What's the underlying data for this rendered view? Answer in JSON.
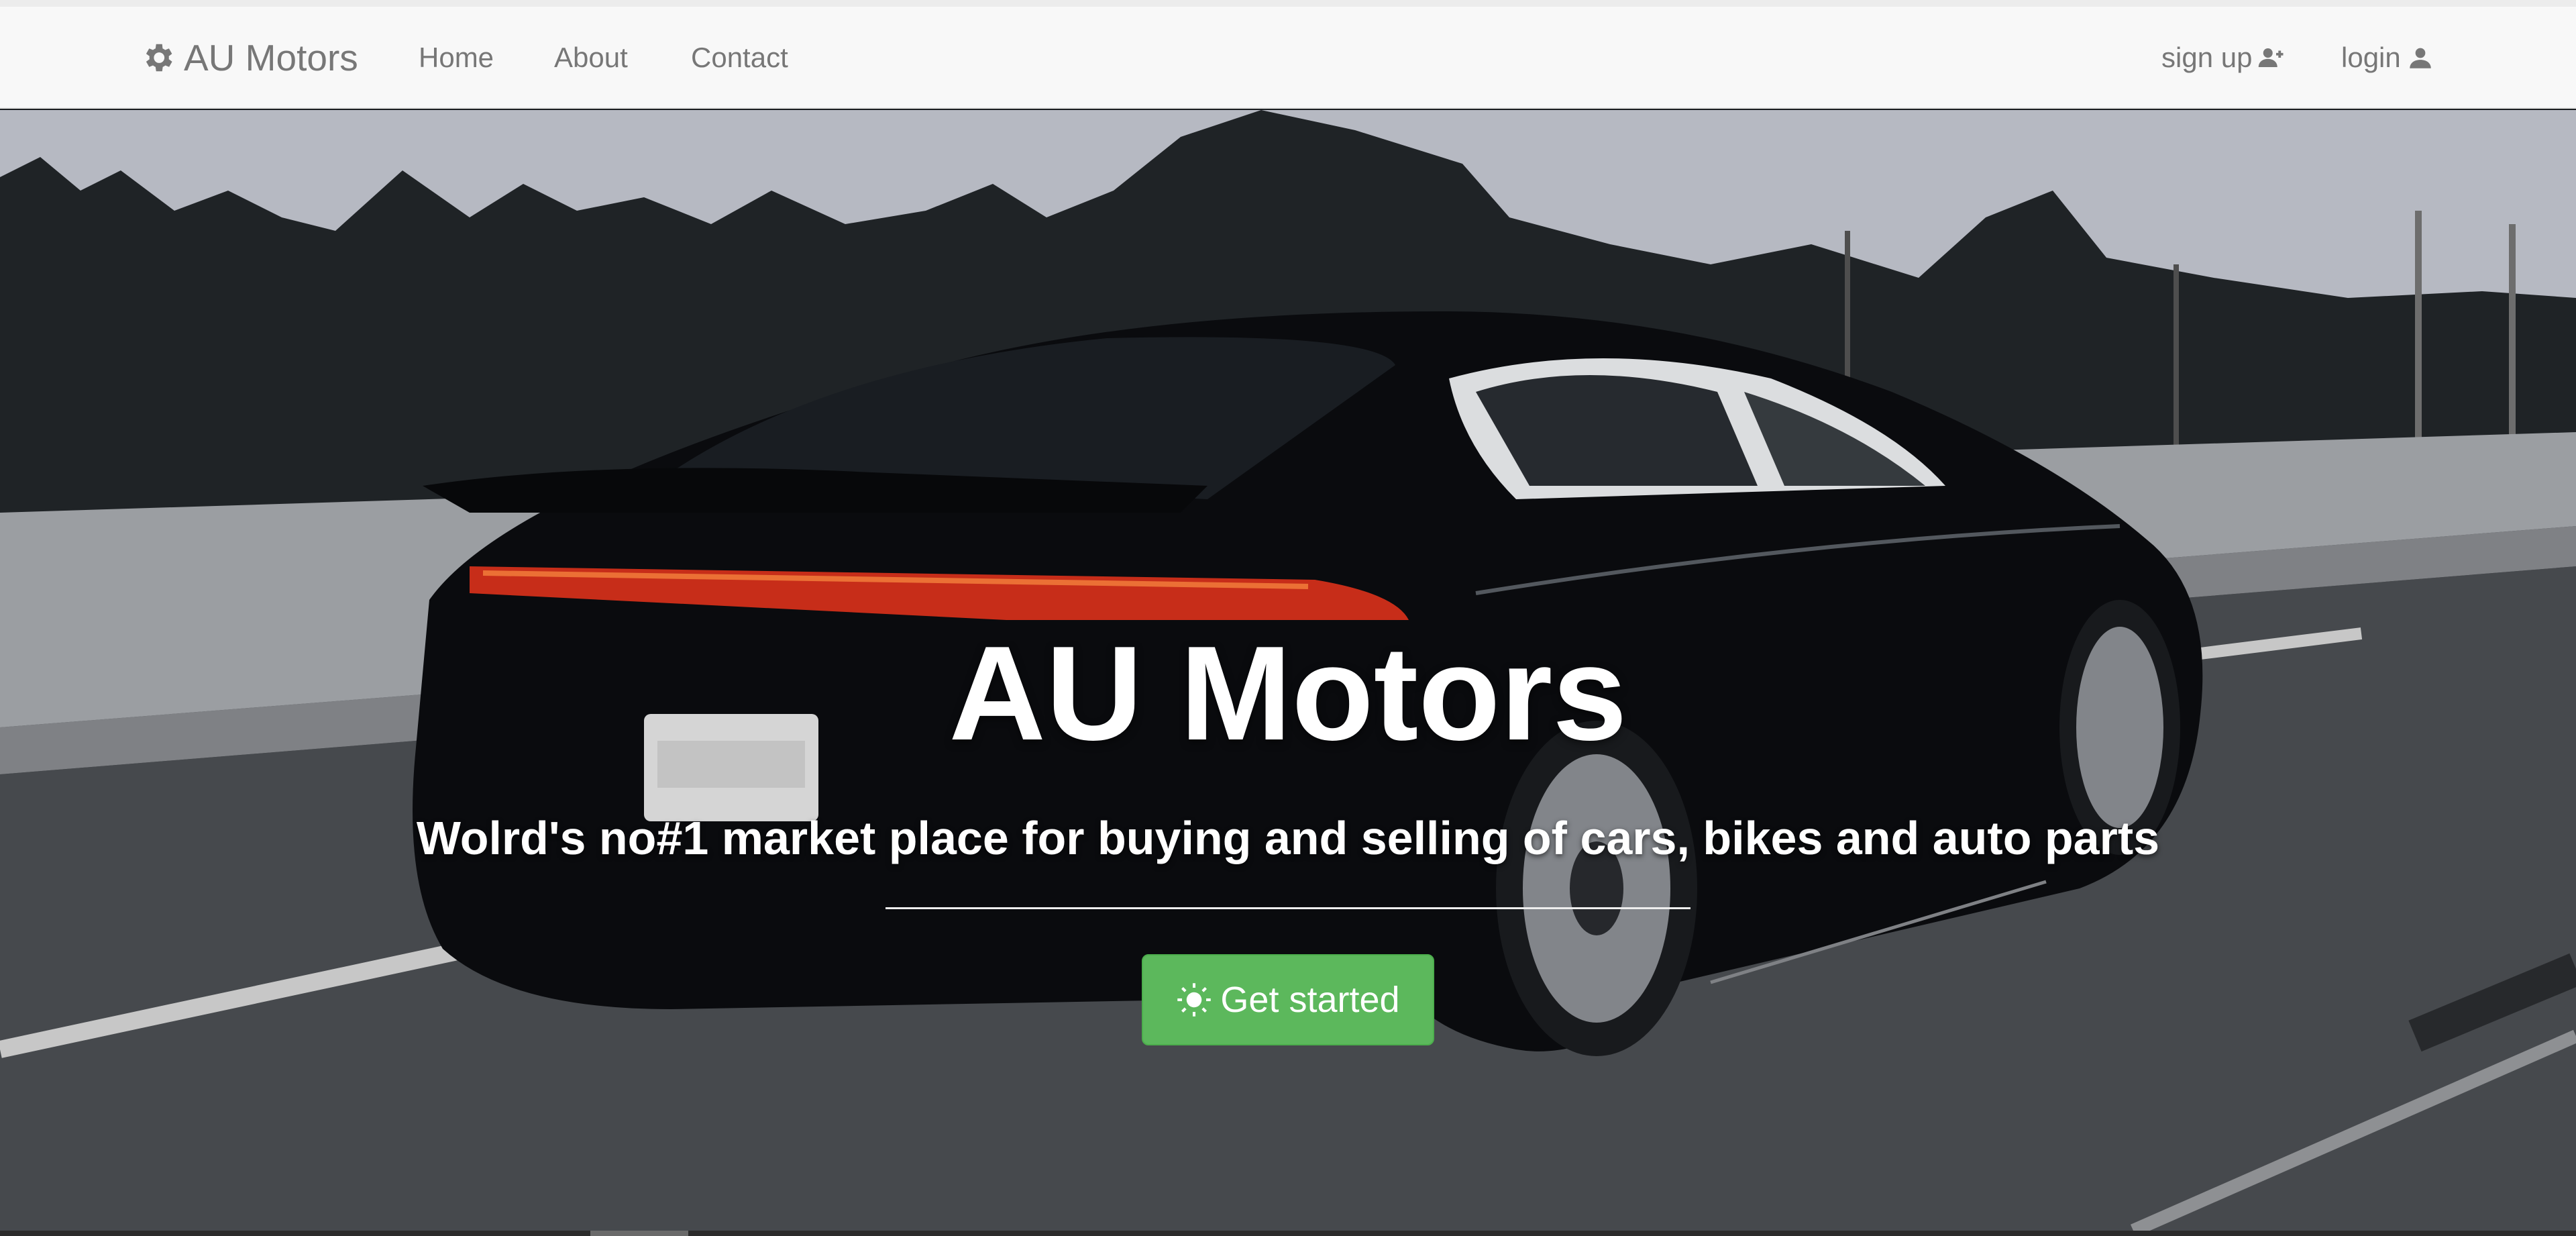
{
  "navbar": {
    "brand": "AU Motors",
    "links": [
      "Home",
      "About",
      "Contact"
    ],
    "signup_label": "sign up",
    "login_label": "login"
  },
  "hero": {
    "title": "AU Motors",
    "subtitle": "Wolrd's no#1 market place for buying and selling of cars, bikes and auto parts",
    "cta_label": "Get started",
    "background": "car-on-highway-photo"
  },
  "icons": {
    "brand": "gear-icon",
    "signup": "user-plus-icon",
    "login": "user-icon",
    "cta": "sun-icon"
  },
  "colors": {
    "navbar_bg": "#f8f8f8",
    "nav_text": "#777777",
    "cta_bg": "#5cb85c",
    "hero_text": "#ffffff"
  }
}
